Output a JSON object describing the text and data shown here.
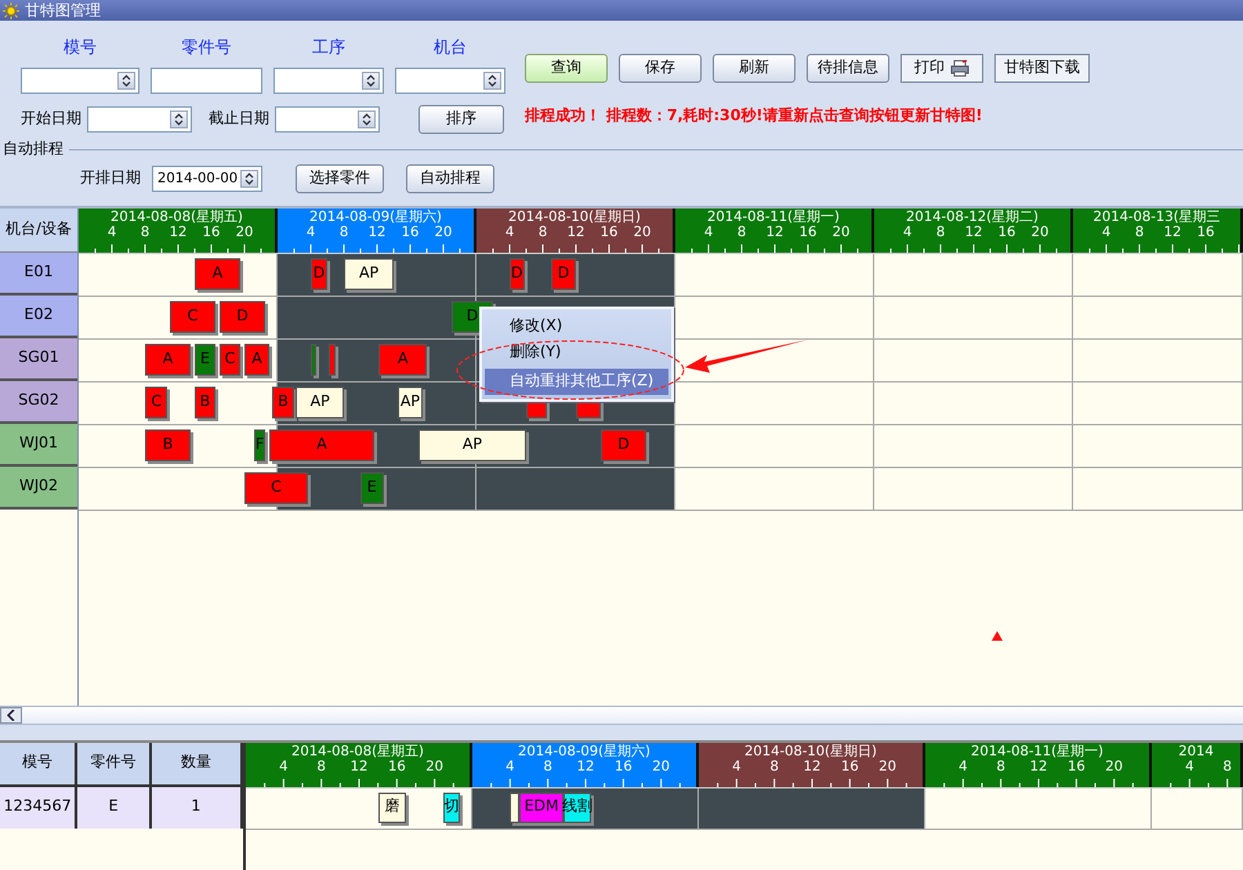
{
  "window": {
    "title": "甘特图管理"
  },
  "filters": {
    "fields": [
      {
        "label": "模号",
        "kind": "select"
      },
      {
        "label": "零件号",
        "kind": "text"
      },
      {
        "label": "工序",
        "kind": "select"
      },
      {
        "label": "机台",
        "kind": "select"
      }
    ],
    "start_date_label": "开始日期",
    "end_date_label": "截止日期",
    "sort_button": "排序"
  },
  "toolbar": [
    {
      "label": "查询",
      "kind": "primary"
    },
    {
      "label": "保存",
      "kind": "plain"
    },
    {
      "label": "刷新",
      "kind": "plain"
    },
    {
      "label": "待排信息",
      "kind": "plain"
    },
    {
      "label": "打印",
      "kind": "print"
    },
    {
      "label": "甘特图下载",
      "kind": "flat"
    }
  ],
  "message": "排程成功！ 排程数：7,耗时:30秒!请重新点击查询按钮更新甘特图!",
  "auto_schedule": {
    "title": "自动排程",
    "date_label": "开排日期",
    "date_value": "2014-00-00",
    "buttons": [
      "选择零件",
      "自动排程"
    ]
  },
  "machine_gantt": {
    "corner": "机台/设备",
    "days": [
      {
        "date": "2014-08-08(星期五)",
        "color": "#0a7a0a",
        "shaded": false,
        "ticks": [
          "4",
          "8",
          "12",
          "16",
          "20"
        ]
      },
      {
        "date": "2014-08-09(星期六)",
        "color": "#0080ff",
        "shaded": true,
        "ticks": [
          "4",
          "8",
          "12",
          "16",
          "20"
        ]
      },
      {
        "date": "2014-08-10(星期日)",
        "color": "#7a3c3c",
        "shaded": true,
        "ticks": [
          "4",
          "8",
          "12",
          "16",
          "20"
        ]
      },
      {
        "date": "2014-08-11(星期一)",
        "color": "#0a7a0a",
        "shaded": false,
        "ticks": [
          "4",
          "8",
          "12",
          "16",
          "20"
        ]
      },
      {
        "date": "2014-08-12(星期二)",
        "color": "#0a7a0a",
        "shaded": false,
        "ticks": [
          "4",
          "8",
          "12",
          "16",
          "20"
        ]
      },
      {
        "date": "2014-08-13(星期三",
        "color": "#0a7a0a",
        "shaded": false,
        "ticks": [
          "4",
          "8",
          "12",
          "16"
        ]
      }
    ],
    "rows": [
      {
        "machine": "E01",
        "color": "#a8b0f0",
        "bars": [
          {
            "label": "A",
            "color": "#ff0000",
            "start": {
              "level": 0.0996
            },
            "end": {
              "level": 0.1388
            }
          },
          {
            "label": "D",
            "color": "#ff0000",
            "start": {
              "level": 0.1993
            },
            "end": {
              "level": 0.2135
            }
          },
          {
            "label": "AP",
            "color": "#fffbe0",
            "start": {
              "level": 0.2278
            },
            "end": {
              "level": 0.2705
            }
          },
          {
            "label": "D",
            "color": "#ff0000",
            "start": {
              "level": 0.3701
            },
            "end": {
              "level": 0.3826
            }
          },
          {
            "label": "D",
            "color": "#ff0000",
            "start": {
              "level": 0.4057
            },
            "end": {
              "level": 0.427
            }
          }
        ]
      },
      {
        "machine": "E02",
        "color": "#a8b0f0",
        "bars": [
          {
            "label": "C",
            "color": "#ff0000",
            "start": {
              "level": 0.0783
            },
            "end": {
              "level": 0.1174
            }
          },
          {
            "label": "D",
            "color": "#ff0000",
            "start": {
              "level": 0.121
            },
            "end": {
              "level": 0.1601
            }
          },
          {
            "label": "D",
            "color": "#0a7a0a",
            "start": {
              "level": 0.3203
            },
            "end": {
              "level": 0.3559
            }
          }
        ]
      },
      {
        "machine": "SG01",
        "color": "#b8a8d8",
        "bars": [
          {
            "label": "A",
            "color": "#ff0000",
            "start": {
              "level": 0.0569
            },
            "end": {
              "level": 0.0961
            }
          },
          {
            "label": "E",
            "color": "#0a7a0a",
            "start": {
              "level": 0.0996
            },
            "end": {
              "level": 0.1174
            }
          },
          {
            "label": "C",
            "color": "#ff0000",
            "start": {
              "level": 0.121
            },
            "end": {
              "level": 0.1388
            }
          },
          {
            "label": "A",
            "color": "#ff0000",
            "start": {
              "level": 0.1423
            },
            "end": {
              "level": 0.1637
            }
          },
          {
            "color": "#0a7a0a",
            "start": {
              "level": 0.1993
            },
            "end": {
              "level": 0.2046
            }
          },
          {
            "color": "#ff0000",
            "start": {
              "level": 0.2153
            },
            "end": {
              "level": 0.2206
            }
          },
          {
            "label": "A",
            "color": "#ff0000",
            "start": {
              "level": 0.258
            },
            "end": {
              "level": 0.2989
            }
          }
        ]
      },
      {
        "machine": "SG02",
        "color": "#b8a8d8",
        "bars": [
          {
            "label": "C",
            "color": "#ff0000",
            "start": {
              "level": 0.0569
            },
            "end": {
              "level": 0.0765
            }
          },
          {
            "label": "B",
            "color": "#ff0000",
            "start": {
              "level": 0.0996
            },
            "end": {
              "level": 0.1174
            }
          },
          {
            "label": "B",
            "color": "#ff0000",
            "start": {
              "level": 0.1661
            },
            "end": {
              "level": 0.1851
            }
          },
          {
            "label": "AP",
            "color": "#fffbe0",
            "start": {
              "level": 0.1868
            },
            "end": {
              "level": 0.2278
            }
          },
          {
            "label": "AP",
            "color": "#fffbe0",
            "start": {
              "level": 0.274
            },
            "end": {
              "level": 0.2954
            }
          },
          {
            "color": "#ff0000",
            "start": {
              "level": 0.3843
            },
            "end": {
              "level": 0.4021
            }
          },
          {
            "color": "#ff0000",
            "start": {
              "level": 0.427
            },
            "end": {
              "level": 0.4484
            }
          }
        ]
      },
      {
        "machine": "WJ01",
        "color": "#88c088",
        "bars": [
          {
            "label": "B",
            "color": "#ff0000",
            "start": {
              "level": 0.0569
            },
            "end": {
              "level": 0.0961
            }
          },
          {
            "label": "F",
            "color": "#0a7a0a",
            "start": {
              "level": 0.1507
            },
            "end": {
              "level": 0.1601
            }
          },
          {
            "label": "A",
            "color": "#ff0000",
            "start": {
              "level": 0.1637
            },
            "end": {
              "level": 0.2539
            }
          },
          {
            "label": "AP",
            "color": "#fffbe0",
            "start": {
              "level": 0.2918
            },
            "end": {
              "level": 0.3843
            }
          },
          {
            "label": "D",
            "color": "#ff0000",
            "start": {
              "level": 0.4484
            },
            "end": {
              "level": 0.4875
            }
          }
        ]
      },
      {
        "machine": "WJ02",
        "color": "#88c088",
        "bars": [
          {
            "label": "C",
            "color": "#ff0000",
            "start": {
              "level": 0.1423
            },
            "end": {
              "level": 0.1969
            }
          },
          {
            "label": "E",
            "color": "#0a7a0a",
            "start": {
              "level": 0.242
            },
            "end": {
              "level": 0.2616
            }
          }
        ]
      }
    ]
  },
  "context_menu": {
    "items": [
      {
        "label": "修改(X)",
        "selected": false
      },
      {
        "label": "删除(Y)",
        "selected": false
      },
      {
        "label": "自动重排其他工序(Z)",
        "selected": true
      }
    ]
  },
  "part_table": {
    "columns": [
      "模号",
      "零件号",
      "数量"
    ],
    "rows": [
      [
        "1234567",
        "E",
        "1"
      ]
    ]
  },
  "process_gantt": {
    "days": [
      {
        "date": "2014-08-08(星期五)",
        "color": "#0a7a0a",
        "shaded": false,
        "ticks": [
          "4",
          "8",
          "12",
          "16",
          "20"
        ]
      },
      {
        "date": "2014-08-09(星期六)",
        "color": "#0080ff",
        "shaded": true,
        "ticks": [
          "4",
          "8",
          "12",
          "16",
          "20"
        ]
      },
      {
        "date": "2014-08-10(星期日)",
        "color": "#7a3c3c",
        "shaded": true,
        "ticks": [
          "4",
          "8",
          "12",
          "16",
          "20"
        ]
      },
      {
        "date": "2014-08-11(星期一)",
        "color": "#0a7a0a",
        "shaded": false,
        "ticks": [
          "4",
          "8",
          "12",
          "16",
          "20"
        ]
      },
      {
        "date": "2014",
        "color": "#0a7a0a",
        "shaded": false,
        "ticks": [
          "4",
          "8"
        ]
      }
    ],
    "rows": [
      {
        "bars": [
          {
            "label": "磨",
            "color": "#fffbe0",
            "start": {
              "level": 0.1325
            },
            "end": {
              "level": 0.1608
            }
          },
          {
            "label": "切",
            "color": "#00f0f0",
            "start": {
              "level": 0.1987
            },
            "end": {
              "level": 0.2145
            }
          },
          {
            "color": "#fffbe0",
            "start": {
              "level": 0.2649
            },
            "end": {
              "level": 0.2744
            }
          },
          {
            "label": "EDM",
            "color": "#ff00ff",
            "start": {
              "level": 0.2744
            },
            "end": {
              "level": 0.3185
            }
          },
          {
            "label": "线割",
            "color": "#00f0f0",
            "start": {
              "level": 0.3185
            },
            "end": {
              "level": 0.3469
            }
          }
        ]
      }
    ]
  }
}
